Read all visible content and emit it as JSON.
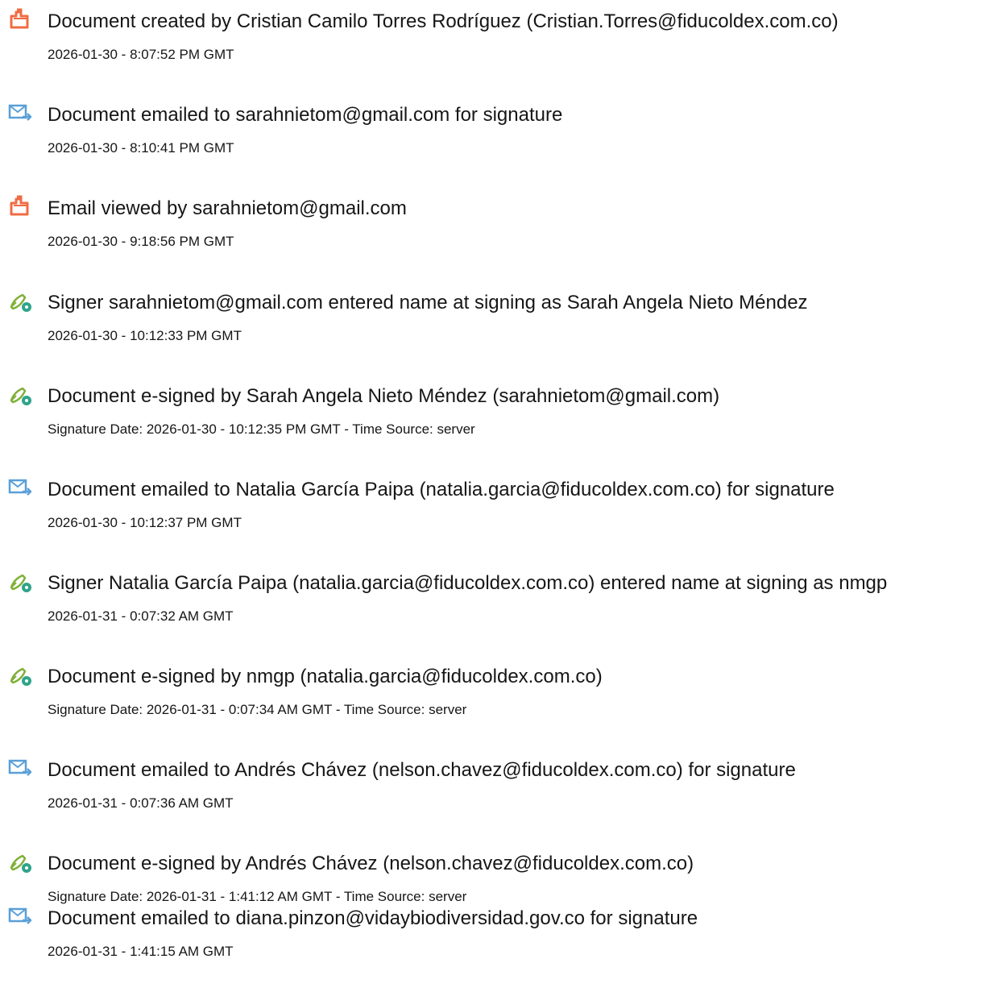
{
  "entries": [
    {
      "icon": "document-created-icon",
      "title": "Document created by Cristian Camilo Torres Rodríguez (Cristian.Torres@fiducoldex.com.co)",
      "detail": "2026-01-30 - 8:07:52 PM GMT"
    },
    {
      "icon": "email-sent-icon",
      "title": "Document emailed to sarahnietom@gmail.com for signature",
      "detail": "2026-01-30 - 8:10:41 PM GMT"
    },
    {
      "icon": "document-viewed-icon",
      "title": "Email viewed by sarahnietom@gmail.com",
      "detail": "2026-01-30 - 9:18:56 PM GMT"
    },
    {
      "icon": "pen-signature-icon",
      "title": "Signer sarahnietom@gmail.com entered name at signing as Sarah Angela Nieto Méndez",
      "detail": "2026-01-30 - 10:12:33 PM GMT"
    },
    {
      "icon": "pen-signature-icon",
      "title": "Document e-signed by Sarah Angela Nieto Méndez (sarahnietom@gmail.com)",
      "detail": "Signature Date: 2026-01-30 - 10:12:35 PM GMT - Time Source: server"
    },
    {
      "icon": "email-sent-icon",
      "title": "Document emailed to Natalia García Paipa (natalia.garcia@fiducoldex.com.co) for signature",
      "detail": "2026-01-30 - 10:12:37 PM GMT"
    },
    {
      "icon": "pen-signature-icon",
      "title": "Signer Natalia García Paipa (natalia.garcia@fiducoldex.com.co) entered name at signing as nmgp",
      "detail": "2026-01-31 - 0:07:32 AM GMT"
    },
    {
      "icon": "pen-signature-icon",
      "title": "Document e-signed by nmgp (natalia.garcia@fiducoldex.com.co)",
      "detail": "Signature Date: 2026-01-31 - 0:07:34 AM GMT - Time Source: server"
    },
    {
      "icon": "email-sent-icon",
      "title": "Document emailed to Andrés Chávez (nelson.chavez@fiducoldex.com.co) for signature",
      "detail": "2026-01-31 - 0:07:36 AM GMT"
    },
    {
      "icon": "pen-signature-icon",
      "title": "Document e-signed by Andrés Chávez (nelson.chavez@fiducoldex.com.co)",
      "detail": "Signature Date: 2026-01-31 - 1:41:12 AM GMT - Time Source: server"
    },
    {
      "icon": "email-sent-icon",
      "title": "Document emailed to diana.pinzon@vidaybiodiversidad.gov.co for signature",
      "detail": "2026-01-31 - 1:41:15 AM GMT"
    }
  ],
  "colors": {
    "document_icon": "#ef6c43",
    "email_icon": "#5a9fd8",
    "pen_icon": "#7fb037",
    "pen_badge": "#2fa48a"
  }
}
